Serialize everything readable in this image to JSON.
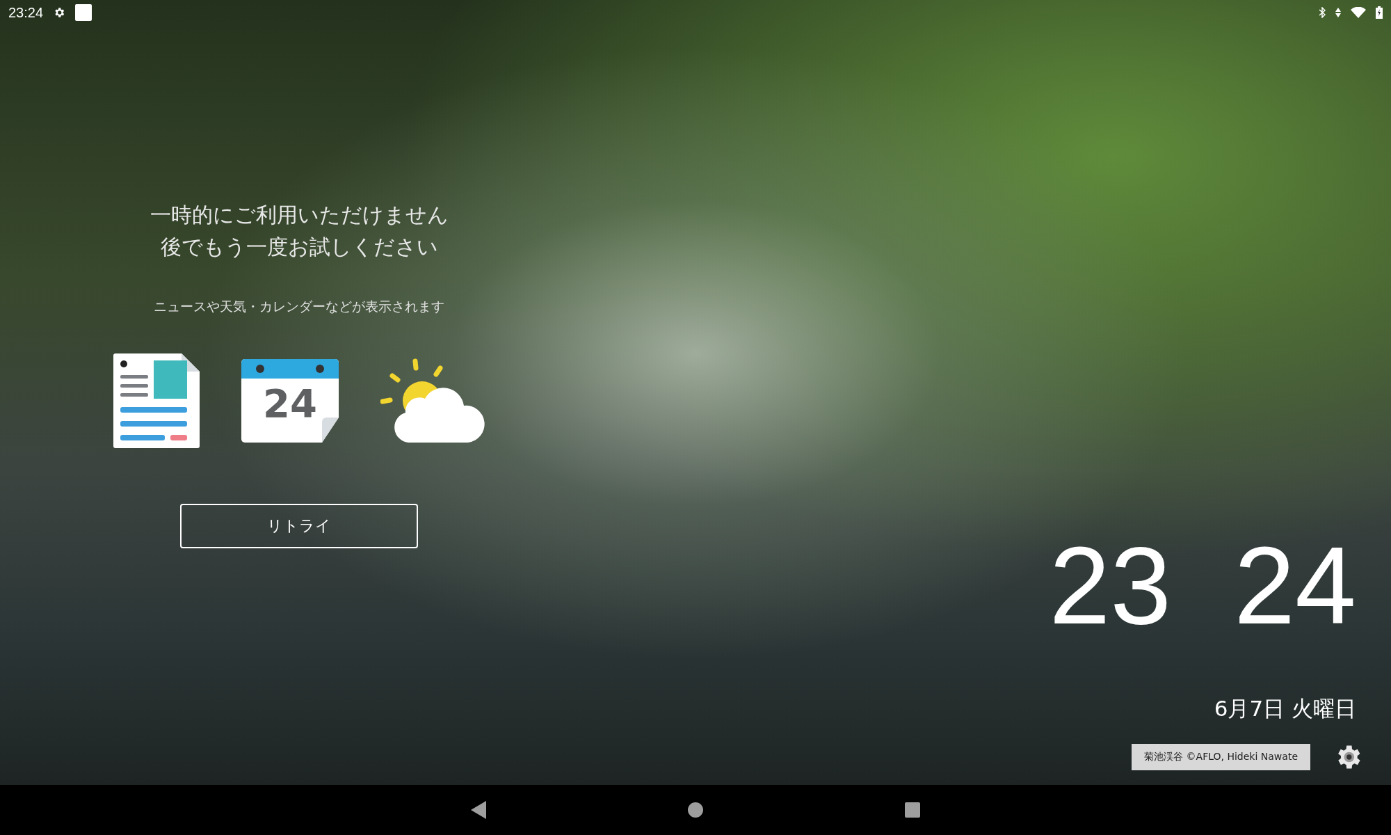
{
  "status_bar": {
    "time": "23:24"
  },
  "message": {
    "title_lines": [
      "一時的にご利用いただけません",
      "後でもう一度お試しください"
    ],
    "description": "ニュースや天気・カレンダーなどが表示されます"
  },
  "feature_icons": [
    {
      "kind": "news"
    },
    {
      "kind": "calendar",
      "day": "24"
    },
    {
      "kind": "weather"
    }
  ],
  "retry_button": "リトライ",
  "clock": {
    "hours": "23",
    "minutes": "24",
    "date": "6月7日 火曜日"
  },
  "photo_credit": "菊池渓谷 ©AFLO, Hideki Nawate"
}
